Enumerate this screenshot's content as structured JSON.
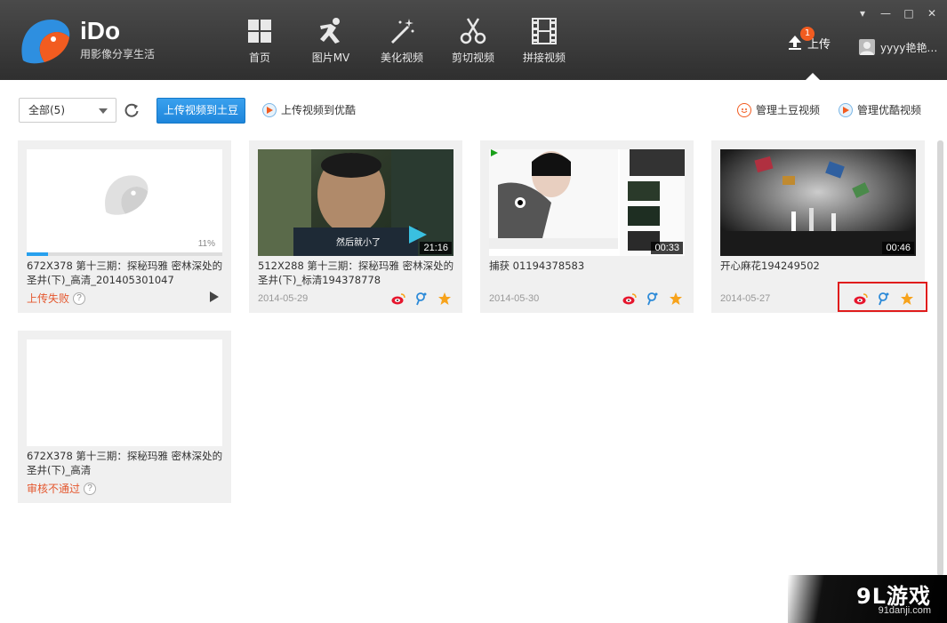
{
  "app": {
    "name": "iDo",
    "slogan": "用影像分享生活"
  },
  "nav": [
    {
      "label": "首页",
      "icon": "grid-icon"
    },
    {
      "label": "图片MV",
      "icon": "dancer-icon"
    },
    {
      "label": "美化视频",
      "icon": "magic-wand-icon"
    },
    {
      "label": "剪切视频",
      "icon": "scissors-icon"
    },
    {
      "label": "拼接视频",
      "icon": "film-strip-icon"
    }
  ],
  "upload_nav": {
    "label": "上传",
    "badge": "1"
  },
  "user": {
    "name": "yyyy艳艳…"
  },
  "toolbar": {
    "filter_value": "全部(5)",
    "upload_tudou_label": "上传视频到土豆",
    "upload_youku_label": "上传视频到优酷",
    "manage_tudou_label": "管理土豆视频",
    "manage_youku_label": "管理优酷视频"
  },
  "cards": [
    {
      "title": "672X378 第十三期：探秘玛雅 密林深处的圣井(下)_高清_201405301047",
      "status": "上传失败",
      "progress_percent": 11,
      "progress_label": "11%"
    },
    {
      "title": "512X288 第十三期：探秘玛雅 密林深处的圣井(下)_标清194378778",
      "date": "2014-05-29",
      "duration": "21:16",
      "caption": "然后就小了"
    },
    {
      "title": "捕获 01194378583",
      "date": "2014-05-30",
      "duration": "00:33"
    },
    {
      "title": "开心麻花194249502",
      "date": "2014-05-27",
      "duration": "00:46"
    },
    {
      "title": "672X378 第十三期：探秘玛雅 密林深处的圣井(下)_高清",
      "status": "审核不通过"
    }
  ],
  "watermark": {
    "main": "9L游戏",
    "sub": "91danji.com"
  },
  "colors": {
    "header_bg": "#3a3a3a",
    "accent_blue": "#1e86db",
    "error_orange": "#e4572e",
    "highlight_red": "#e01c1c"
  }
}
